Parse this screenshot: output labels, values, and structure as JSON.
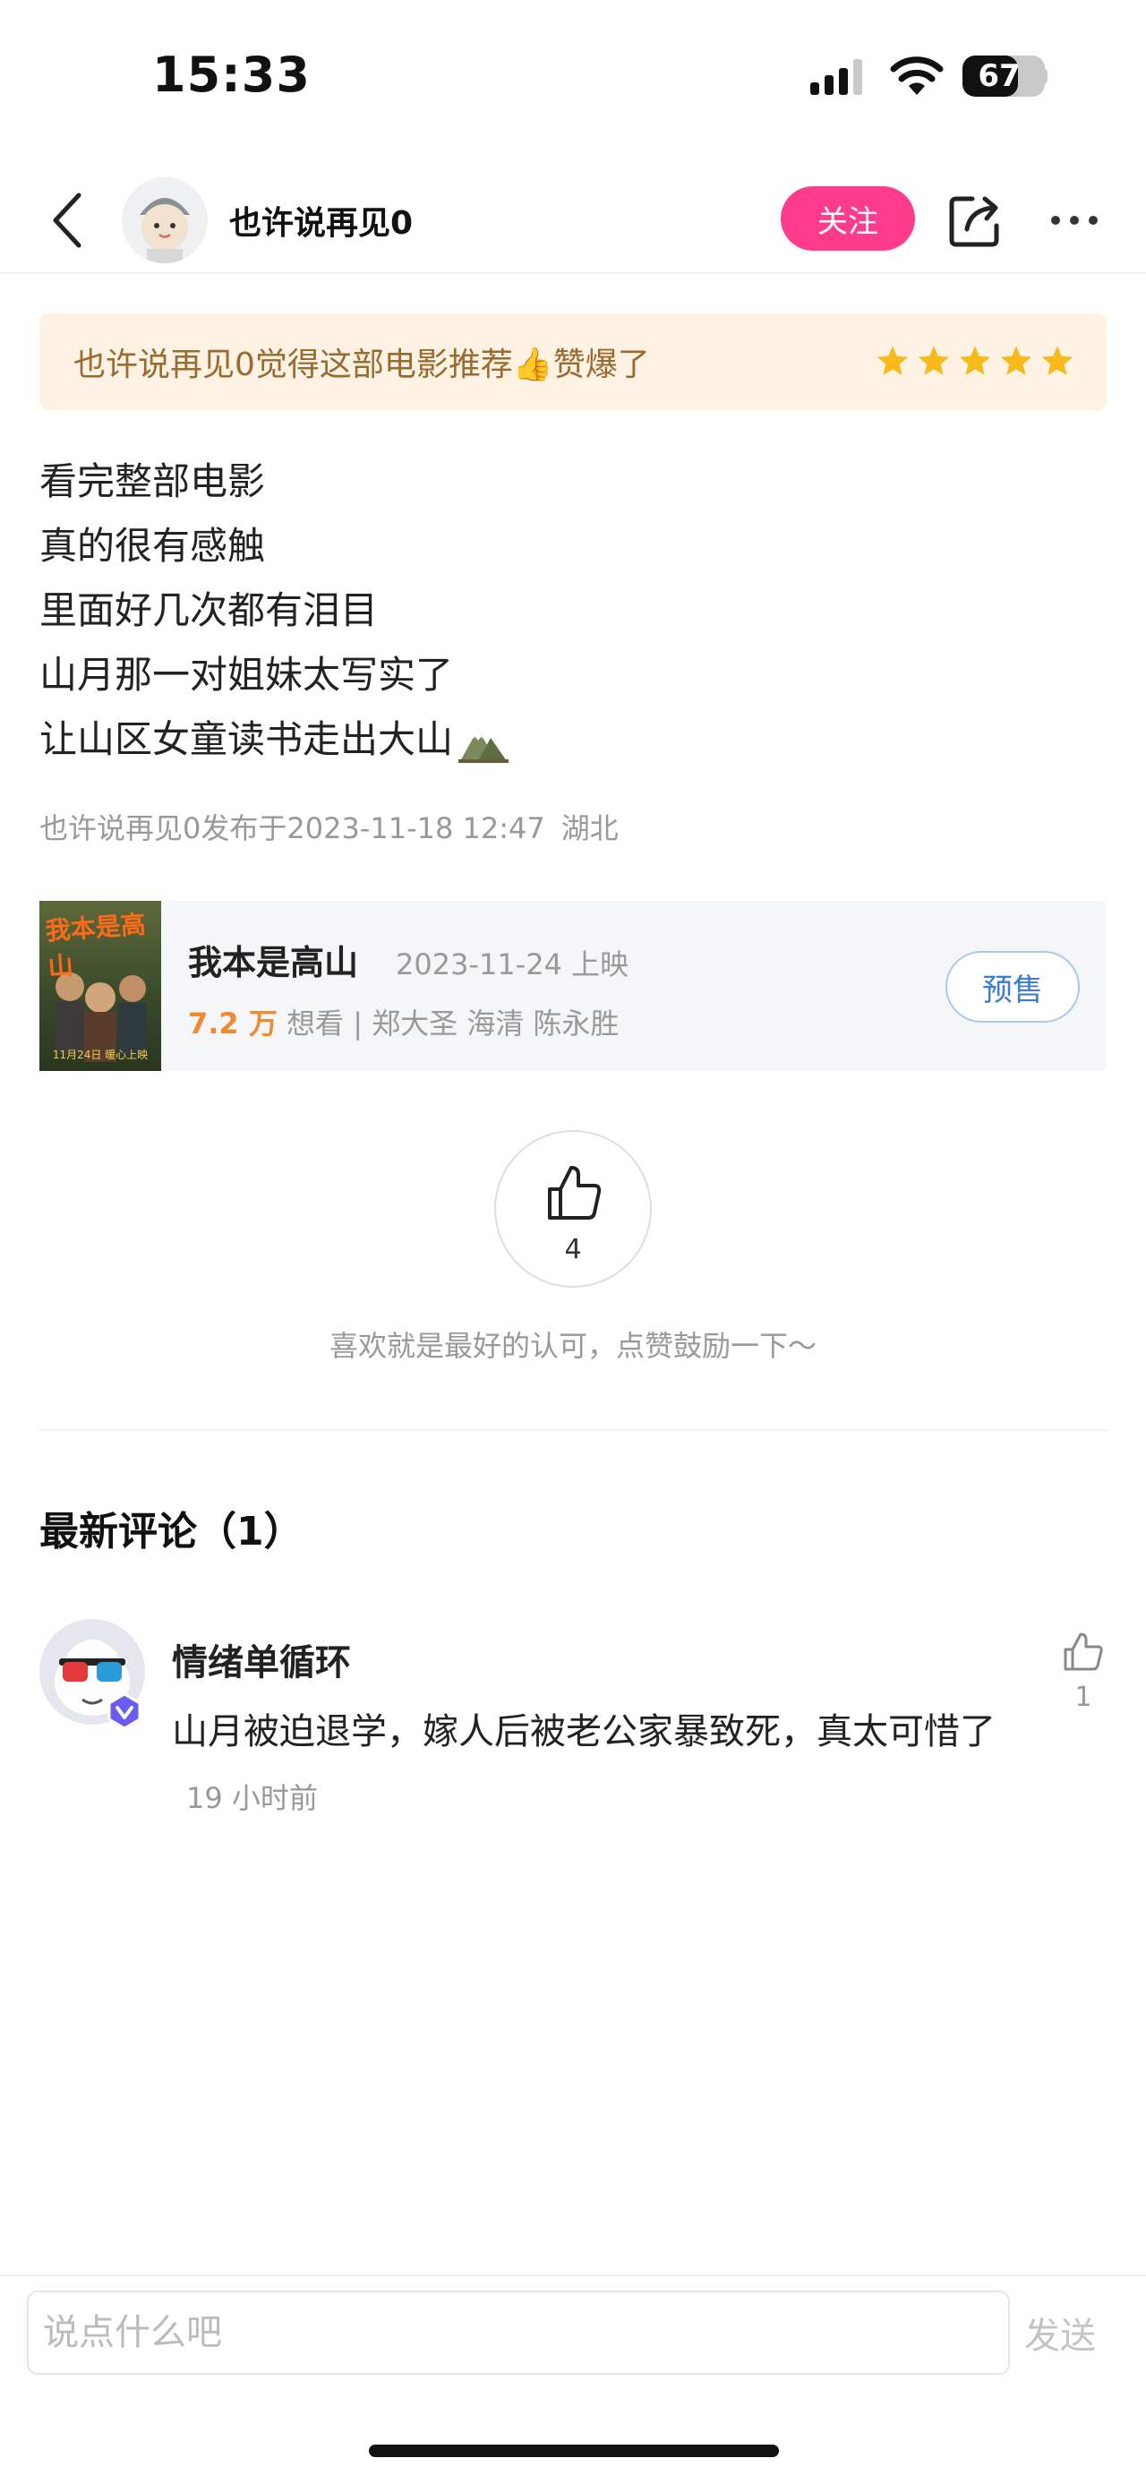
{
  "status_bar": {
    "time": "15:33",
    "battery": "67",
    "battery_level": 0.67
  },
  "nav": {
    "username": "也许说再见0",
    "follow_label": "关注"
  },
  "rating": {
    "text": "也许说再见0觉得这部电影推荐👍赞爆了",
    "stars": 5
  },
  "review": {
    "lines": [
      "看完整部电影",
      "真的很有感触",
      "里面好几次都有泪目",
      "山月那一对姐妹太写实了",
      "让山区女童读书走出大山"
    ],
    "meta": "也许说再见0发布于2023-11-18 12:47",
    "location": "湖北"
  },
  "movie": {
    "title": "我本是高山",
    "release": "2023-11-24 上映",
    "want_count": "7.2 万",
    "want_label": "想看",
    "cast": "| 郑大圣 海清 陈永胜",
    "presale_label": "预售",
    "poster_title": "我本是高山",
    "poster_date": "11月24日 暖心上映"
  },
  "like": {
    "count": "4",
    "hint": "喜欢就是最好的认可，点赞鼓励一下～"
  },
  "comments": {
    "title": "最新评论（1）",
    "items": [
      {
        "user": "情绪单循环",
        "text": "山月被迫退学，嫁人后被老公家暴致死，真太可惜了",
        "time": "19 小时前",
        "likes": "1"
      }
    ]
  },
  "input": {
    "placeholder": "说点什么吧",
    "send_label": "发送"
  }
}
